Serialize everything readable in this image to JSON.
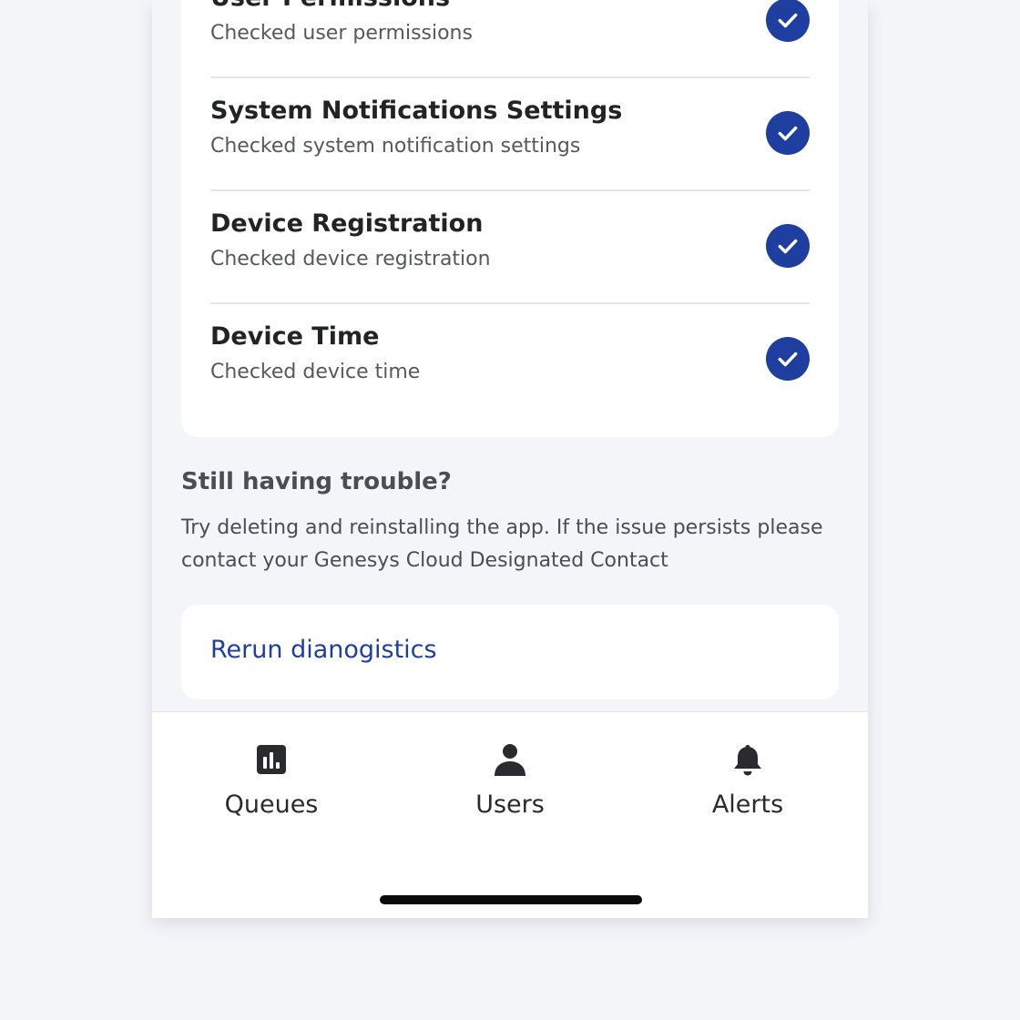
{
  "checks": [
    {
      "title": "User Permissions",
      "subtitle": "Checked user permissions",
      "icon": "check-circle-icon"
    },
    {
      "title": "System Notifications Settings",
      "subtitle": "Checked system notification settings",
      "icon": "check-circle-icon"
    },
    {
      "title": "Device Registration",
      "subtitle": "Checked device registration",
      "icon": "check-circle-icon"
    },
    {
      "title": "Device Time",
      "subtitle": "Checked device time",
      "icon": "check-circle-icon"
    }
  ],
  "trouble": {
    "title": "Still having trouble?",
    "body": "Try deleting and reinstalling the app. If the issue persists please contact your Genesys Cloud Designated Contact"
  },
  "rerun": {
    "label": "Rerun dianogistics"
  },
  "tabs": [
    {
      "label": "Queues",
      "icon": "queues-chart-icon"
    },
    {
      "label": "Users",
      "icon": "user-icon"
    },
    {
      "label": "Alerts",
      "icon": "bell-icon"
    }
  ],
  "colors": {
    "accent": "#1f3fa0",
    "background": "#f4f5f9",
    "card": "#ffffff"
  }
}
